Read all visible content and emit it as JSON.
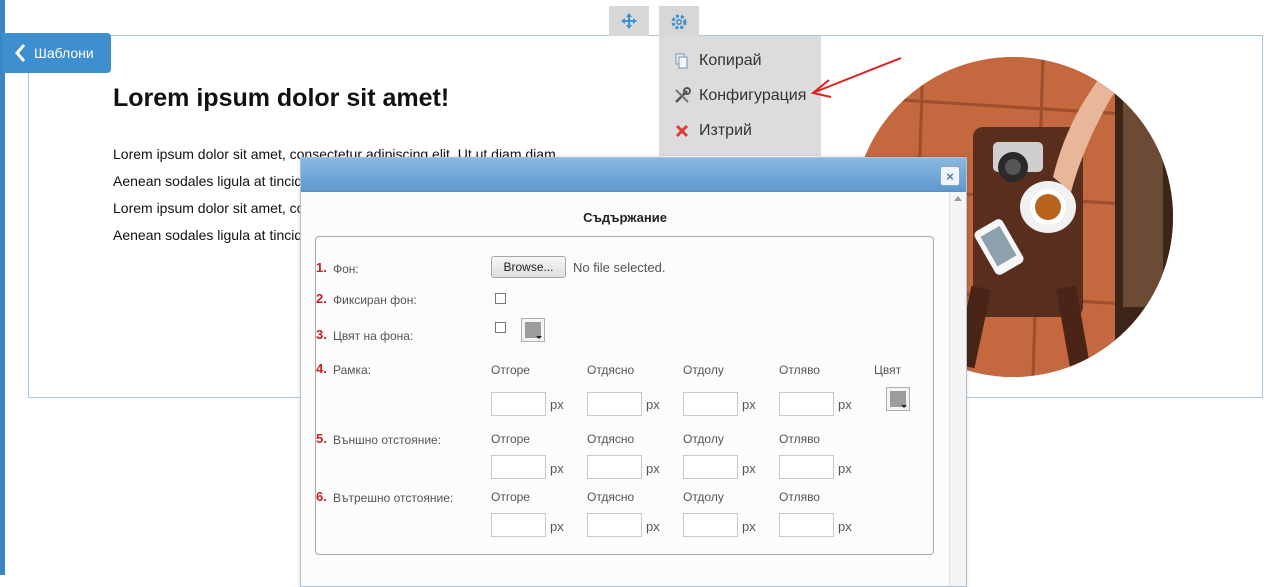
{
  "nav": {
    "back_label": "Шаблони"
  },
  "toolbar": {
    "move_icon": "move-arrows-icon",
    "settings_icon": "gear-icon"
  },
  "menu": {
    "items": [
      {
        "label": "Копирай",
        "icon": "copy-icon"
      },
      {
        "label": "Конфигурация",
        "icon": "tools-icon"
      },
      {
        "label": "Изтрий",
        "icon": "delete-x-icon"
      }
    ]
  },
  "content": {
    "title": "Lorem ipsum dolor sit amet!",
    "paragraphs": [
      "Lorem ipsum dolor sit amet, consectetur adipiscing elit. Ut ut diam diam.",
      "Aenean sodales ligula at tincidunt",
      "Lorem ipsum dolor sit amet, consectetur",
      "Aenean sodales ligula at tincidunt"
    ]
  },
  "dialog": {
    "title": "Съдържание",
    "close_label": "×",
    "rows": [
      {
        "number": "1.",
        "label": "Фон:"
      },
      {
        "number": "2.",
        "label": "Фиксиран фон:"
      },
      {
        "number": "3.",
        "label": "Цвят на фона:"
      },
      {
        "number": "4.",
        "label": "Рамка:"
      },
      {
        "number": "5.",
        "label": "Външно отстояние:"
      },
      {
        "number": "6.",
        "label": "Вътрешно отстояние:"
      }
    ],
    "browse_label": "Browse...",
    "no_file_text": "No file selected.",
    "sides": [
      "Отгоре",
      "Отдясно",
      "Отдолу",
      "Отляво"
    ],
    "color_label": "Цвят",
    "unit": "px"
  },
  "colors": {
    "accent": "#3d8fd0",
    "dialog_header": "#5d9ad0",
    "number_red": "#cc1f1f",
    "annotation_red": "#e02020"
  }
}
